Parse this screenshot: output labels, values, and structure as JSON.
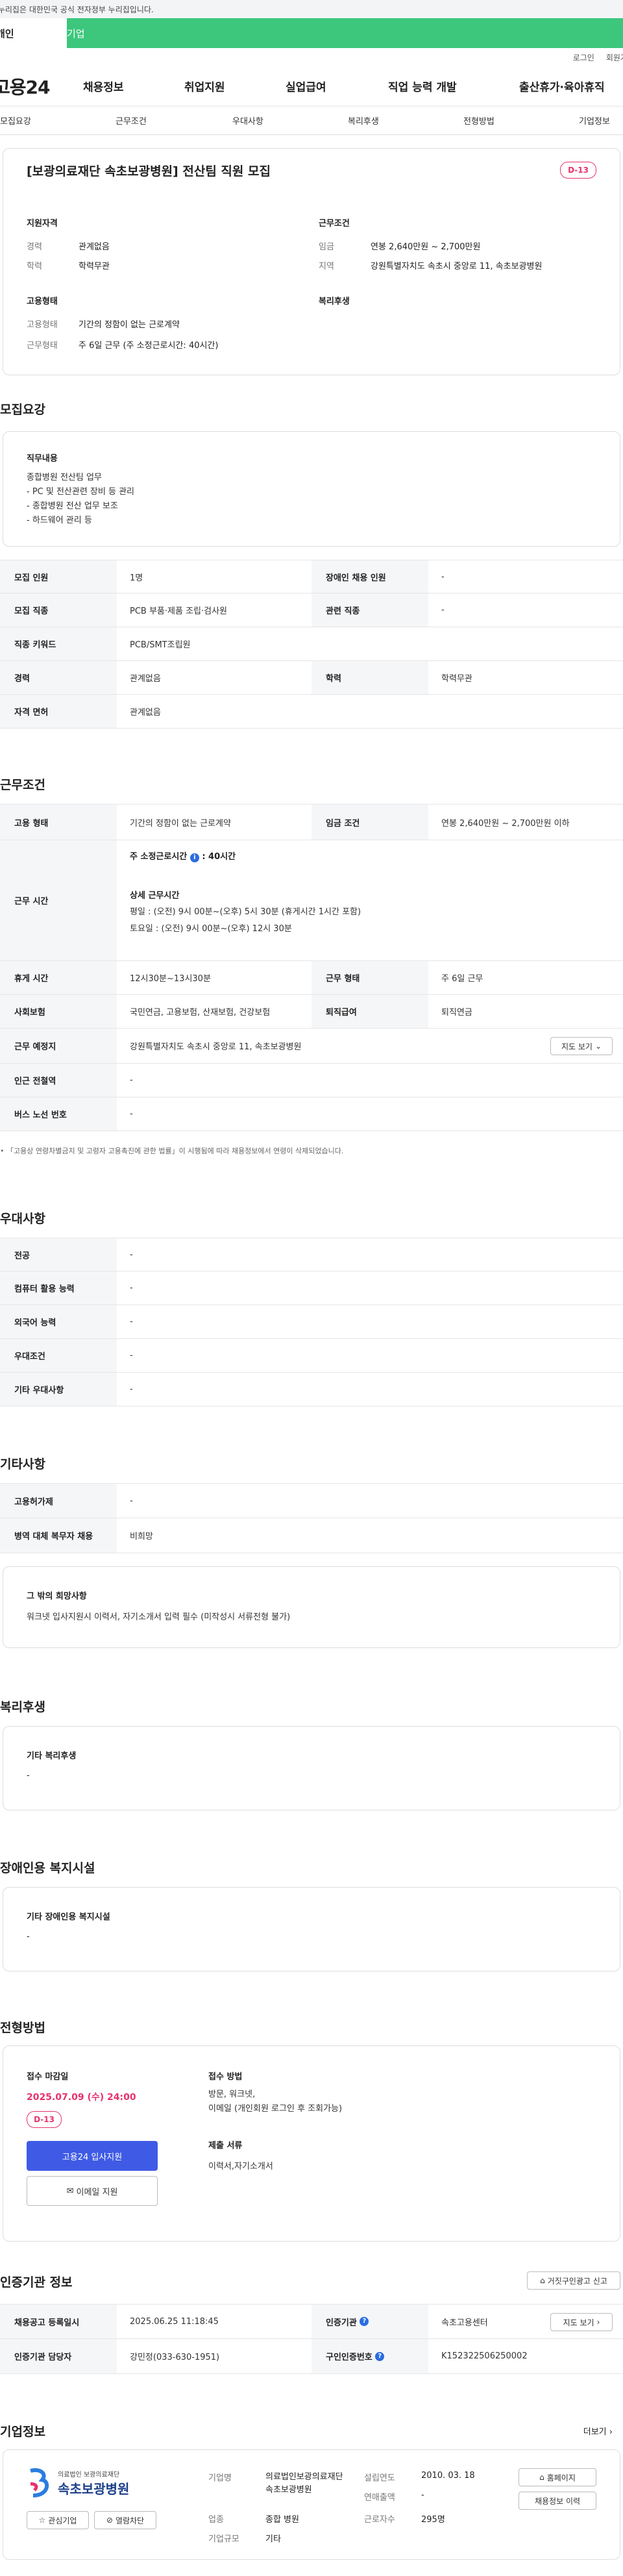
{
  "gov_notice": "이 누리집은 대한민국 공식 전자정부 누리집입니다.",
  "tabs": {
    "personal": "개인",
    "company": "기업"
  },
  "util": {
    "login": "로그인",
    "signup": "회원가입"
  },
  "logo": "고용24",
  "gnb": [
    "채용정보",
    "취업지원",
    "실업급여",
    "직업 능력 개발",
    "출산휴가·육아휴직"
  ],
  "subnav": [
    "모집요강",
    "근무조건",
    "우대사항",
    "복리후생",
    "전형방법",
    "기업정보"
  ],
  "job": {
    "title": "[보광의료재단 속초보광병원] 전산팀 직원 모집",
    "dday": "D-13",
    "qual_head": "지원자격",
    "cond_head": "근무조건",
    "emp_head": "고용형태",
    "welfare_head": "복리후생",
    "career_lbl": "경력",
    "career": "관계없음",
    "edu_lbl": "학력",
    "edu": "학력무관",
    "wage_lbl": "임금",
    "wage": "연봉 2,640만원 ~ 2,700만원",
    "region_lbl": "지역",
    "region": "강원특별자치도 속초시 중앙로 11, 속초보광병원",
    "emptype_lbl": "고용형태",
    "emptype": "기간의 정함이 없는 근로계약",
    "worktype_lbl": "근무형태",
    "worktype": "주 6일 근무 (주 소정근로시간: 40시간)"
  },
  "recruit": {
    "heading": "모집요강",
    "duty_head": "직무내용",
    "duty": "종합병원 전산팀 업무\n- PC 및 전산관련 장비 등 관리\n- 종합병원 전산 업무 보조\n- 하드웨어 관리 등",
    "rows": [
      {
        "k1": "모집 인원",
        "v1": "1명",
        "k2": "장애인 채용 인원",
        "v2": "-"
      },
      {
        "k1": "모집 직종",
        "v1": "PCB 부품·제품 조립·검사원",
        "k2": "관련 직종",
        "v2": "-"
      },
      {
        "k1": "직종 키워드",
        "v1": "PCB/SMT조립원"
      },
      {
        "k1": "경력",
        "v1": "관계없음",
        "k2": "학력",
        "v2": "학력무관"
      },
      {
        "k1": "자격 면허",
        "v1": "관계없음"
      }
    ]
  },
  "conditions": {
    "heading": "근무조건",
    "emp_k": "고용 형태",
    "emp_v": "기간의 정함이 없는 근로계약",
    "wage_k": "임금 조건",
    "wage_v": "연봉 2,640만원 ~ 2,700만원 이하",
    "hours_k": "근무 시간",
    "hours_weekly_lbl": "주 소정근로시간",
    "hours_weekly": ": 40시간",
    "hours_detail_lbl": "상세 근무시간",
    "hours_detail": "평일 : (오전) 9시 00분~(오후) 5시 30분 (휴게시간 1시간 포함)\n토요일 : (오전) 9시 00분~(오후) 12시 30분",
    "rest_k": "휴게 시간",
    "rest_v": "12시30분~13시30분",
    "form_k": "근무 형태",
    "form_v": "주 6일 근무",
    "ins_k": "사회보험",
    "ins_v": "국민연금, 고용보험, 산재보험, 건강보험",
    "sev_k": "퇴직급여",
    "sev_v": "퇴직연금",
    "place_k": "근무 예정지",
    "place_v": "강원특별자치도 속초시 중앙로 11, 속초보광병원",
    "map_btn": "지도 보기",
    "subway_k": "인근 전철역",
    "subway_v": "-",
    "bus_k": "버스 노선 번호",
    "bus_v": "-",
    "note": "「고용상 연령차별금지 및 고령자 고용촉진에 관한 법률」이 시행됨에 따라 채용정보에서 연령이 삭제되었습니다."
  },
  "pref": {
    "heading": "우대사항",
    "rows": [
      [
        "전공",
        "-"
      ],
      [
        "컴퓨터 활용 능력",
        "-"
      ],
      [
        "외국어 능력",
        "-"
      ],
      [
        "우대조건",
        "-"
      ],
      [
        "기타 우대사항",
        "-"
      ]
    ]
  },
  "etc": {
    "heading": "기타사항",
    "rows": [
      [
        "고용허가제",
        "-"
      ],
      [
        "병역 대체 복무자 채용",
        "비희망"
      ]
    ],
    "other_head": "그 밖의 희망사항",
    "other": "워크넷 입사지원시 이력서, 자기소개서 입력 필수 (미작성시 서류전형 불가)"
  },
  "welfare": {
    "heading": "복리후생",
    "head": "기타 복리후생",
    "value": "-"
  },
  "disabled": {
    "heading": "장애인용 복지시설",
    "head": "기타 장애인용 복지시설",
    "value": "-"
  },
  "process": {
    "heading": "전형방법",
    "deadline_lbl": "접수 마감일",
    "deadline": "2025.07.09 (수) 24:00",
    "dday": "D-13",
    "apply_btn": "고용24 입사지원",
    "email_btn": "이메일 지원",
    "method_lbl": "접수 방법",
    "method": "방문, 워크넷,\n이메일 (개인회원 로그인 후 조회가능)",
    "docs_lbl": "제출 서류",
    "docs": "이력서,자기소개서"
  },
  "cert": {
    "heading": "인증기관 정보",
    "report_btn": "거짓구인광고 신고",
    "reg_k": "채용공고 등록일시",
    "reg_v": "2025.06.25 11:18:45",
    "org_k": "인증기관",
    "org_v": "속초고용센터",
    "map_btn": "지도 보기",
    "mgr_k": "인증기관 담당자",
    "mgr_v": "강민정(033-630-1951)",
    "auth_k": "구인인증번호",
    "auth_v": "K152322506250002"
  },
  "company": {
    "heading": "기업정보",
    "more": "더보기",
    "logo_sub": "의료법인 보광의료재단",
    "logo_main": "속초보광병원",
    "fav_btn": "관심기업",
    "block_btn": "열람차단",
    "name_k": "기업명",
    "name_v": "의료법인보광의료재단속초보광병원",
    "ind_k": "업종",
    "ind_v": "종합 병원",
    "size_k": "기업규모",
    "size_v": "기타",
    "est_k": "설립연도",
    "est_v": "2010. 03. 18",
    "sales_k": "연매출액",
    "sales_v": "-",
    "emp_k": "근로자수",
    "emp_v": "295명",
    "home_btn": "홈페이지",
    "hist_btn": "채용정보 이력"
  }
}
